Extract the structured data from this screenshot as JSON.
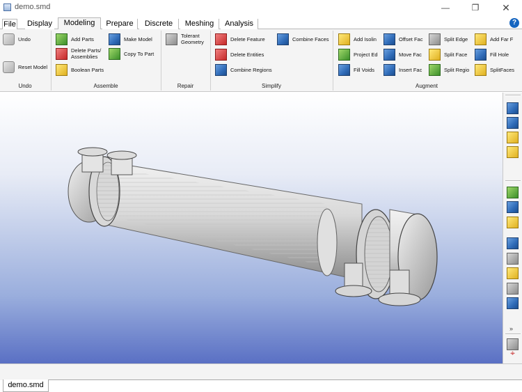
{
  "window": {
    "title": "demo.smd",
    "minimize": "—",
    "maximize": "❐",
    "close": "✕"
  },
  "tabs": [
    "File",
    "Display",
    "Modeling",
    "Prepare",
    "Discrete",
    "Meshing",
    "Analysis"
  ],
  "active_tab": "Modeling",
  "help": "?",
  "ribbon": {
    "undo_group": {
      "label": "Undo",
      "undo": "Undo",
      "reset_model": "Reset Model"
    },
    "assemble_group": {
      "label": "Assemble",
      "add_parts": "Add Parts",
      "delete_parts": "Delete Parts/ Assemblies",
      "boolean_parts": "Boolean Parts",
      "make_model": "Make Model",
      "copy_to_part": "Copy To Part"
    },
    "repair_group": {
      "label": "Repair",
      "tolerant_geometry": "Tolerant Geometry"
    },
    "simplify_group": {
      "label": "Simplify",
      "delete_feature": "Delete Feature",
      "delete_entities": "Delete Entities",
      "combine_regions": "Combine Regions",
      "combine_faces": "Combine Faces"
    },
    "augment_group": {
      "label": "Augment",
      "add_isolin": "Add Isolin",
      "project_ed": "Project Ed",
      "fill_voids": "Fill Voids",
      "offset_fac": "Offset Fac",
      "move_fac": "Move Fac",
      "insert_fac": "Insert Fac",
      "split_edge": "Split Edge",
      "split_face": "Split Face",
      "split_regio": "Split Regio",
      "add_far_f": "Add Far F",
      "fill_hole": "Fill Hole",
      "split_faces": "SplitFaces"
    }
  },
  "side_toolbar": {
    "icons": [
      "view-iso-icon",
      "view-front-icon",
      "view-top-icon",
      "view-side-icon",
      "fit-view-icon",
      "mesh-view-icon",
      "shaded-view-icon",
      "info-icon",
      "solid-icon",
      "select-point-icon",
      "wireframe-icon",
      "shell-icon",
      "camera-icon",
      "rotate-center-icon"
    ],
    "chevron": "»"
  },
  "document_tab": "demo.smd",
  "colors": {
    "viewport_top": "#ffffff",
    "viewport_bottom": "#5a70c4",
    "accent": "#1565c0"
  }
}
